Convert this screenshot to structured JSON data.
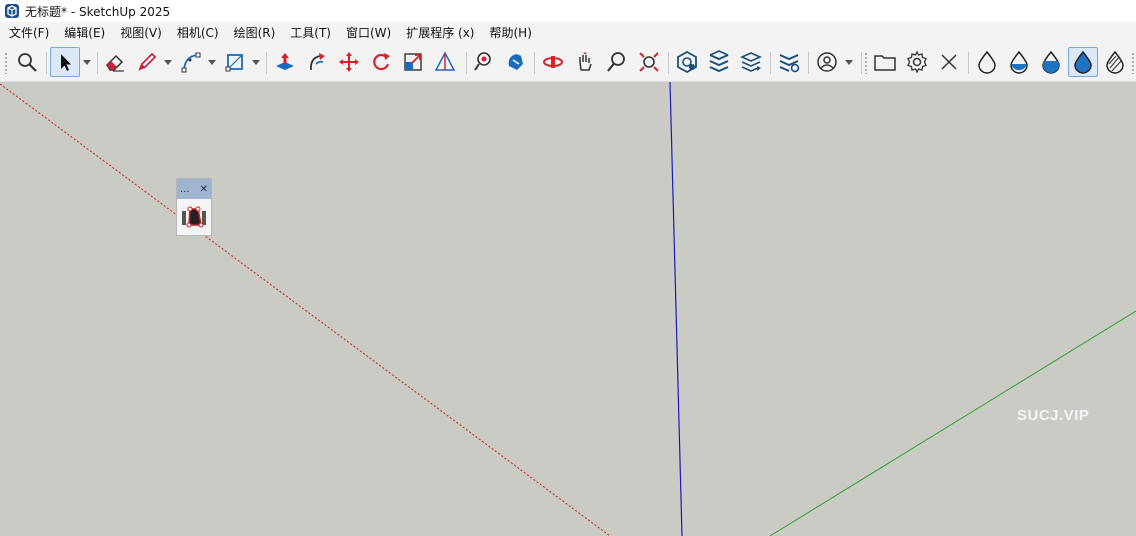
{
  "window": {
    "title": "无标题* - SketchUp 2025",
    "app_icon": "sketchup-logo-icon"
  },
  "menu": [
    {
      "id": "file",
      "label": "文件(F)"
    },
    {
      "id": "edit",
      "label": "编辑(E)"
    },
    {
      "id": "view",
      "label": "视图(V)"
    },
    {
      "id": "camera",
      "label": "相机(C)"
    },
    {
      "id": "draw",
      "label": "绘图(R)"
    },
    {
      "id": "tools",
      "label": "工具(T)"
    },
    {
      "id": "window",
      "label": "窗口(W)"
    },
    {
      "id": "extensions",
      "label": "扩展程序 (x)"
    },
    {
      "id": "help",
      "label": "帮助(H)"
    }
  ],
  "toolbar": {
    "tools": [
      "zoom-search-icon",
      "select-arrow-icon",
      "eraser-icon",
      "pencil-line-icon",
      "arc-icon",
      "rectangle-icon",
      "push-pull-icon",
      "follow-me-icon",
      "move-icon",
      "rotate-icon",
      "scale-icon",
      "tape-measure-icon",
      "position-camera-icon",
      "walk-icon",
      "orbit-icon",
      "pan-icon",
      "zoom-icon",
      "zoom-extents-icon",
      "model-info-icon",
      "tags-icon",
      "layers-icon",
      "styles-icon",
      "account-icon",
      "open-folder-icon",
      "settings-icon",
      "close-icon",
      "xray-drop-icon",
      "hidden-line-drop-icon",
      "shaded-drop-icon",
      "shaded-textures-drop-icon",
      "monochrome-drop-icon"
    ],
    "active_tool": "shaded-textures-drop-icon",
    "accent": "#1f73c4"
  },
  "viewport": {
    "background": "#cbcbc6",
    "axis_colors": {
      "red": "#c81e1e",
      "green": "#2e9e2e",
      "blue": "#1a1ab4"
    }
  },
  "floating_toolbar": {
    "title_dots": "...",
    "close_glyph": "✕",
    "tool_icon": "sandbox-from-contours-icon"
  },
  "watermark": "SUCJ.VIP"
}
